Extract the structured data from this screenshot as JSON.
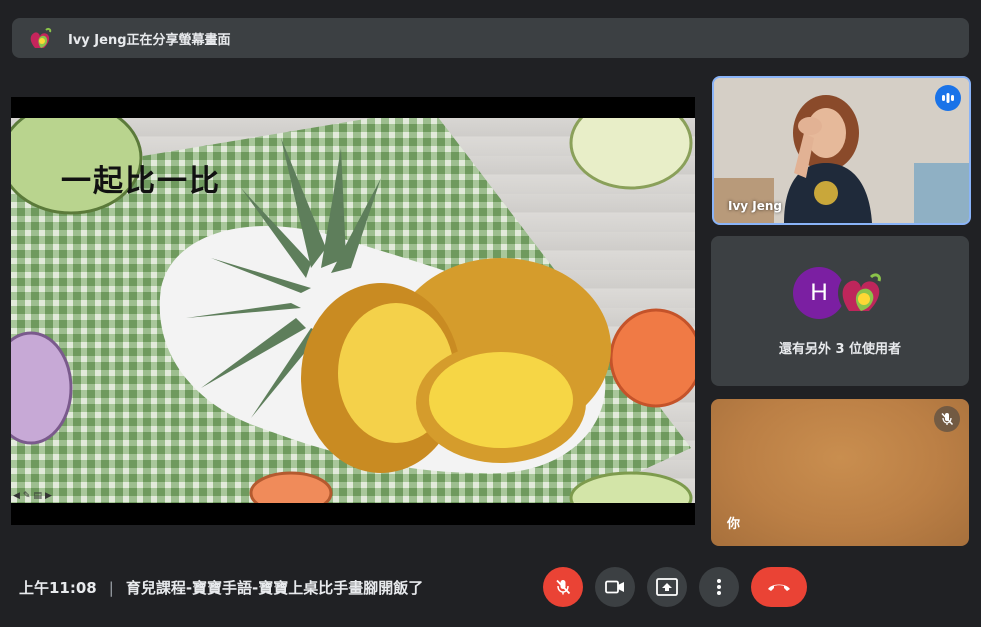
{
  "banner": {
    "presenting_text": "Ivy Jeng正在分享螢幕畫面",
    "icon": "baby-sign-logo-icon"
  },
  "presentation": {
    "slide_title": "一起比一比",
    "slide_image": "pineapple-illustration"
  },
  "participants": {
    "self_tile": {
      "name": "Ivy Jeng",
      "status_icon": "speaking-icon"
    },
    "others_tile": {
      "avatar_letter": "H",
      "avatar_color": "#7b1fa2",
      "label": "還有另外 3 位使用者"
    },
    "you_tile": {
      "name": "你",
      "status_icon": "mic-off-icon"
    }
  },
  "footer": {
    "time": "上午11:08",
    "separator": "|",
    "meeting_title": "育兒課程-寶寶手語-寶寶上桌比手畫腳開飯了"
  },
  "controls": [
    {
      "name": "mic-toggle",
      "icon": "mic-off-icon",
      "color": "#ea4335"
    },
    {
      "name": "camera-toggle",
      "icon": "camera-icon",
      "color": "#3c4043"
    },
    {
      "name": "present-now",
      "icon": "present-screen-icon",
      "color": "#3c4043"
    },
    {
      "name": "more-options",
      "icon": "more-vert-icon",
      "color": "#3c4043"
    },
    {
      "name": "leave-call",
      "icon": "hang-up-icon",
      "color": "#ea4335"
    }
  ],
  "colors": {
    "background": "#202124",
    "surface": "#3c4043",
    "accent_blue": "#1a73e8",
    "highlight_border": "#8ab4f8",
    "danger": "#ea4335"
  }
}
